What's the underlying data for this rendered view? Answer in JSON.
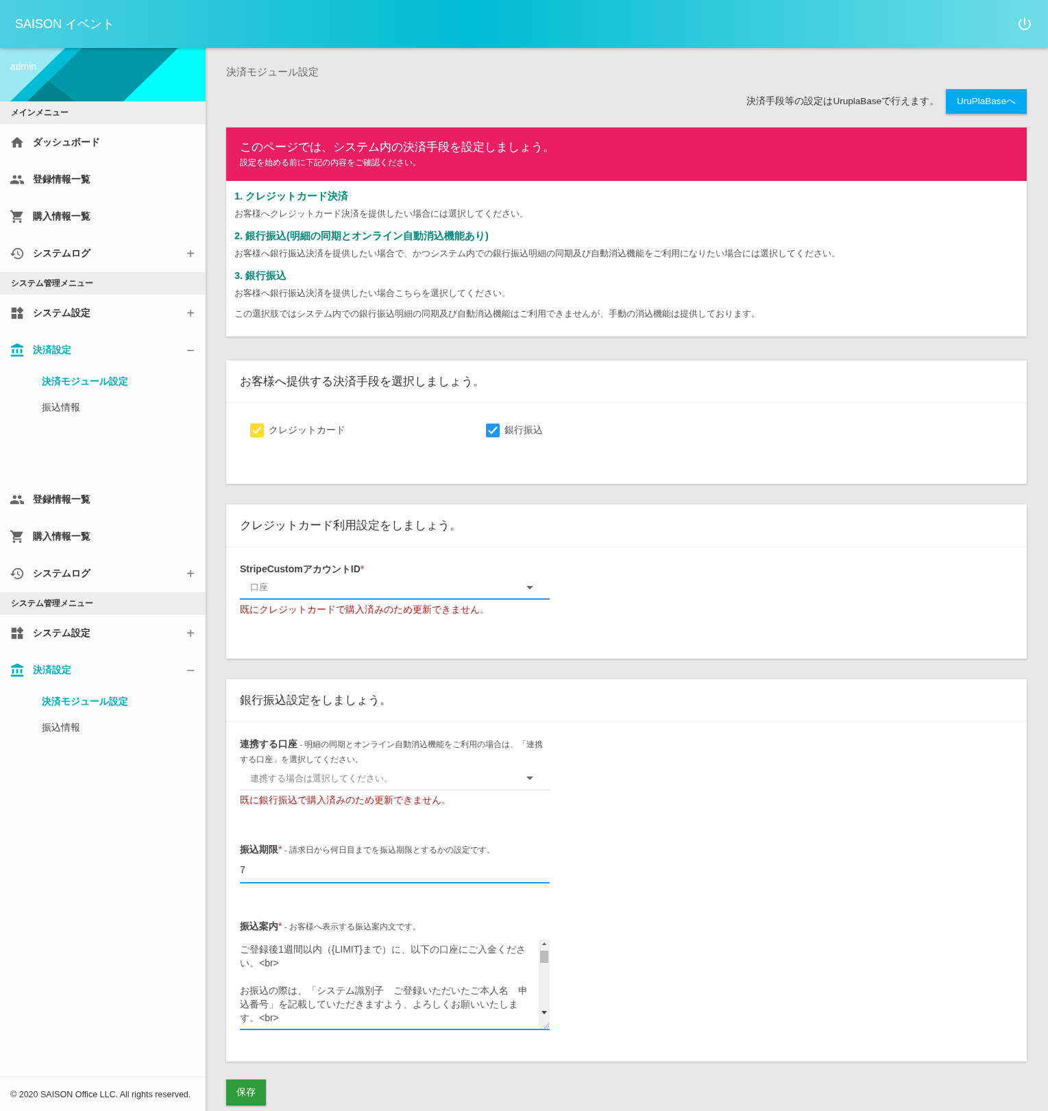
{
  "header": {
    "title": "SAISON イベント"
  },
  "sidebar": {
    "user": "admin",
    "blocks": [
      {
        "entries": [
          {
            "kind": "heading",
            "label": "メインメニュー"
          },
          {
            "kind": "dashboard",
            "label": "ダッシュボード"
          },
          {
            "kind": "registrations",
            "label": "登録情報一覧"
          },
          {
            "kind": "purchases",
            "label": "購入情報一覧"
          },
          {
            "kind": "log",
            "label": "システムログ",
            "toggle": "+",
            "expanded": false
          },
          {
            "kind": "heading",
            "label": "システム管理メニュー"
          },
          {
            "kind": "settings",
            "label": "システム設定",
            "toggle": "+",
            "expanded": false
          },
          {
            "kind": "payment",
            "label": "決済設定",
            "toggle": "−",
            "expanded": true,
            "children": [
              {
                "label": "決済モジュール設定",
                "selected": true
              },
              {
                "label": "振込情報",
                "selected": false
              }
            ]
          }
        ]
      },
      {
        "entries": [
          {
            "kind": "registrations",
            "label": "登録情報一覧"
          },
          {
            "kind": "purchases",
            "label": "購入情報一覧"
          },
          {
            "kind": "log",
            "label": "システムログ",
            "toggle": "+",
            "expanded": false
          },
          {
            "kind": "heading",
            "label": "システム管理メニュー"
          },
          {
            "kind": "settings",
            "label": "システム設定",
            "toggle": "+",
            "expanded": false
          },
          {
            "kind": "payment",
            "label": "決済設定",
            "toggle": "−",
            "expanded": true,
            "children": [
              {
                "label": "決済モジュール設定",
                "selected": true
              },
              {
                "label": "振込情報",
                "selected": false
              }
            ]
          }
        ]
      }
    ],
    "footer": "© 2020 SAISON Office LLC. All rights reserved."
  },
  "page": {
    "title": "決済モジュール設定",
    "info": "決済手段等の設定はUruplaBaseで行えます。",
    "link_button": "UruPlaBaseへ"
  },
  "intro": {
    "title": "このページでは、システム内の決済手段を設定しましょう。",
    "subtitle": "設定を始める前に下記の内容をご確認ください。",
    "sections": [
      {
        "heading": "1. クレジットカード決済",
        "paragraphs": [
          "お客様へクレジットカード決済を提供したい場合には選択してください。"
        ]
      },
      {
        "heading": "2. 銀行振込(明細の同期とオンライン自動消込機能あり)",
        "paragraphs": [
          "お客様へ銀行振込決済を提供したい場合で、かつシステム内での銀行振込明細の同期及び自動消込機能をご利用になりたい場合には選択してください。"
        ]
      },
      {
        "heading": "3. 銀行振込",
        "paragraphs": [
          "お客様へ銀行振込決済を提供したい場合こちらを選択してください。",
          "この選択肢ではシステム内での銀行振込明細の同期及び自動消込機能はご利用できませんが、手動の消込機能は提供しております。"
        ]
      }
    ]
  },
  "payment_methods": {
    "title": "お客様へ提供する決済手段を選択しましょう。",
    "items": [
      {
        "label": "クレジットカード",
        "checked": true,
        "color": "#fdd835"
      },
      {
        "label": "銀行振込",
        "checked": true,
        "color": "#2196f3"
      }
    ]
  },
  "credit_card": {
    "title": "クレジットカード利用設定をしましょう。",
    "fields": [
      {
        "kind": "select",
        "label": "StripeCustomアカウントID",
        "asterisk": "*",
        "placeholder": "口座",
        "focused": true,
        "error": "既にクレジットカードで購入済みのため更新できません。"
      }
    ]
  },
  "bank_transfer": {
    "title": "銀行振込設定をしましょう。",
    "fields": [
      {
        "kind": "select",
        "label": "連携する口座",
        "hint": "- 明細の同期とオンライン自動消込機能をご利用の場合は、「連携する口座」を選択してください。",
        "placeholder": "連携する場合は選択してください。",
        "focused": false,
        "error": "既に銀行振込で購入済みのため更新できません。"
      },
      {
        "kind": "input",
        "label": "振込期限",
        "asterisk": "*",
        "hint": "- 請求日から何日目までを振込期限とするかの設定です。",
        "value": "7",
        "focused": true
      },
      {
        "kind": "textarea",
        "label": "振込案内",
        "asterisk": "*",
        "hint": "- お客様へ表示する振込案内文です。",
        "value": "ご登録後1週間以内（{LIMIT}まで）に、以下の口座にご入金ください。<br>\n\nお振込の際は、「システム識別子　ご登録いただいたご本人名　申込番号」を記載していただきますよう、よろしくお願いいたします。<br>",
        "focused": true
      }
    ]
  },
  "save_button": "保存"
}
